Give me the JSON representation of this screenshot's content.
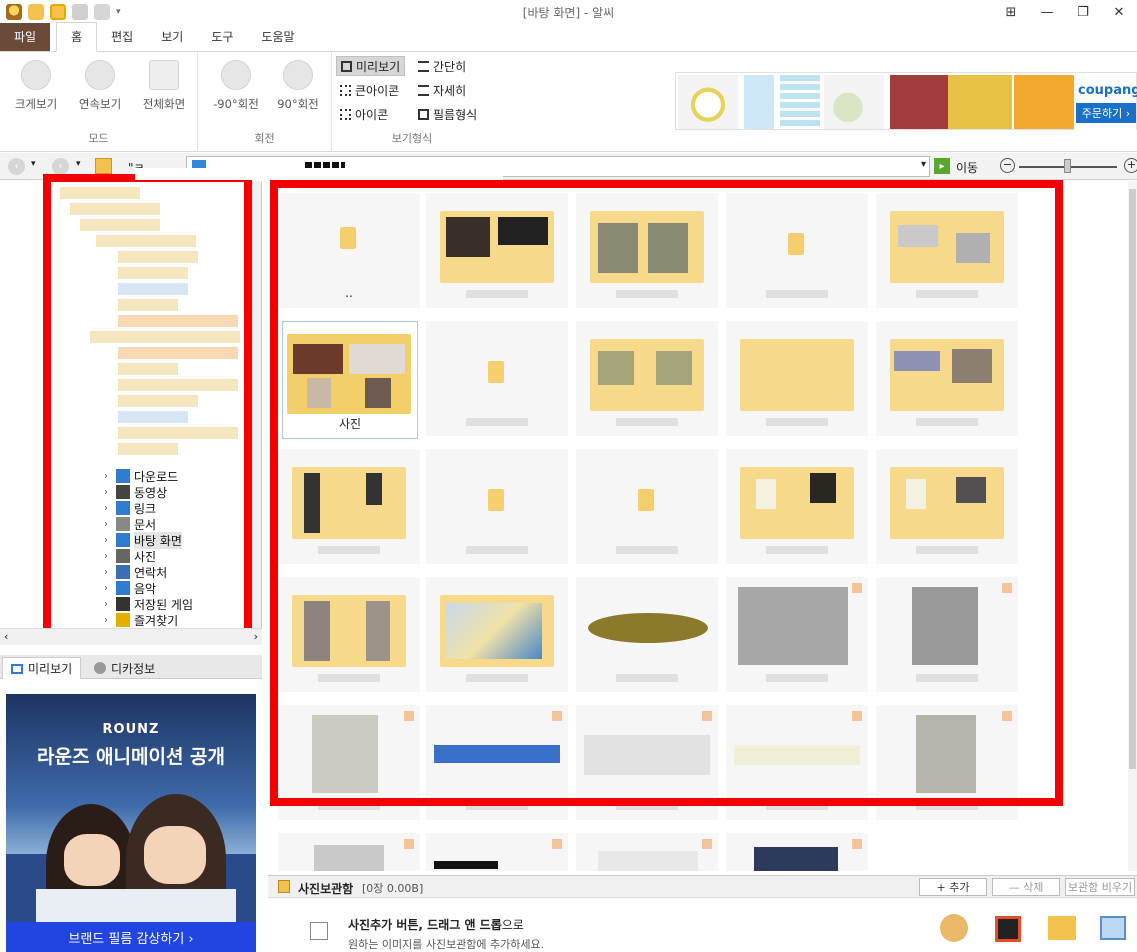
{
  "window": {
    "title": "[바탕 화면] - 알씨",
    "controls": [
      "⊞",
      "—",
      "❐",
      "✕"
    ]
  },
  "menu": {
    "tabs": [
      "파일",
      "홈",
      "편집",
      "보기",
      "도구",
      "도움말"
    ],
    "active": "홈"
  },
  "ribbon": {
    "mode_group": {
      "label": "모드",
      "buttons": [
        "크게보기",
        "연속보기",
        "전체화면"
      ]
    },
    "rotate_group": {
      "label": "회전",
      "buttons": [
        "-90°회전",
        "90°회전"
      ]
    },
    "view_group": {
      "label": "보기형식",
      "options": [
        "미리보기",
        "간단히",
        "큰아이콘",
        "자세히",
        "아이콘",
        "필름형식"
      ],
      "selected": "미리보기"
    }
  },
  "ad": {
    "brand": "coupang",
    "cta": "주문하기 ›"
  },
  "address": {
    "go_label": "이동",
    "back": "‹",
    "forward": "›",
    "prefix": "\"ㅋ"
  },
  "tree": {
    "items": [
      {
        "label": "다운로드",
        "color": "#2f7bd1"
      },
      {
        "label": "동영상",
        "color": "#444444"
      },
      {
        "label": "링크",
        "color": "#2f7bd1"
      },
      {
        "label": "문서",
        "color": "#888888"
      },
      {
        "label": "바탕 화면",
        "color": "#2f7bd1"
      },
      {
        "label": "사진",
        "color": "#666666"
      },
      {
        "label": "연락처",
        "color": "#3b6fb5"
      },
      {
        "label": "음악",
        "color": "#2f7bd1"
      },
      {
        "label": "저장된 게임",
        "color": "#333333"
      },
      {
        "label": "즐겨찾기",
        "color": "#e3b000"
      }
    ],
    "selected": "바탕 화면"
  },
  "panel_tabs": [
    "미리보기",
    "디카정보"
  ],
  "banner": {
    "brand": "ROUNZ",
    "headline": "라운즈 애니메이션 공개",
    "cta": "브랜드 필름 감상하기 ›"
  },
  "grid": {
    "parent_label": "..",
    "selected_label": "사진"
  },
  "photobox": {
    "title": "사진보관함",
    "count": "[0장 0.00B]",
    "add": "+ 추가",
    "delete": "— 삭제",
    "clear": "보관함 비우기",
    "hint_bold": "사진추가 버튼, 드래그 앤 드롭",
    "hint_suffix": "으로",
    "hint_line2": "원하는 이미지를 사진보관함에 추가하세요."
  }
}
